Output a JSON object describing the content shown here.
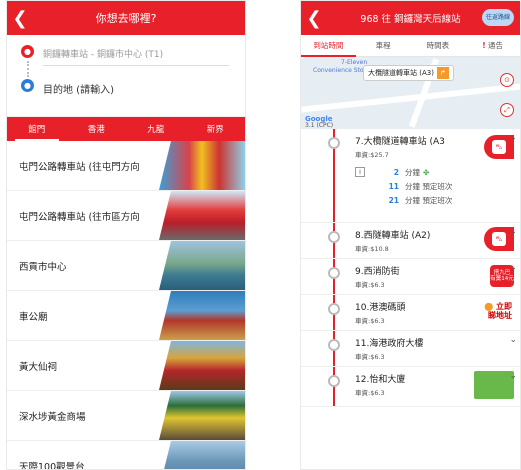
{
  "left": {
    "header_title": "你想去哪裡?",
    "origin": "銅鑼轉車站 - 銅鑼市中心 (T1)",
    "destination_placeholder": "目的地 (請輸入)",
    "tabs": [
      "館門",
      "香港",
      "九龍",
      "新界"
    ],
    "active_tab": 0,
    "places": [
      {
        "label": "屯門公路轉車站 (往屯門方向"
      },
      {
        "label": "屯門公路轉車站 (往市區方向"
      },
      {
        "label": "西貢市中心"
      },
      {
        "label": "車公廟"
      },
      {
        "label": "黃大仙祠"
      },
      {
        "label": "深水埗黃金商場"
      },
      {
        "label": "天際100觀景台"
      }
    ]
  },
  "right": {
    "header_title": "968 往 銅鑼灣天后線站",
    "header_pill": "往返路線",
    "tabs": [
      "到站時間",
      "車程",
      "時間表",
      "通告"
    ],
    "active_tab": 0,
    "map": {
      "callout": "大欖隧道轉車站 (A3)",
      "label_seven": "7-Eleven",
      "label_conv": "Convenience Store",
      "google": "Google",
      "bottom_left": "3.1 (CPC)"
    },
    "stops": [
      {
        "name": "7.大欖隧道轉車站 (A3",
        "fare": "車資:$25.7",
        "eta": [
          {
            "n": "2",
            "text": "分鐘"
          },
          {
            "n": "11",
            "text": "分鐘 預定班次"
          },
          {
            "n": "21",
            "text": "分鐘 預定班次"
          }
        ]
      },
      {
        "name": "8.西隧轉車站 (A2)",
        "fare": "車資:$10.8"
      },
      {
        "name": "9.西消防街",
        "fare": "車資:$6.3"
      },
      {
        "name": "10.港澳碼頭",
        "fare": "車資:$6.3"
      },
      {
        "name": "11.海港政府大樓",
        "fare": "車資:$6.3"
      },
      {
        "name": "12.怡和大廈",
        "fare": "車資:$6.3"
      }
    ],
    "walk_label": "立即\n睇地址",
    "ad_label": "搭九巴\n有獎14元"
  }
}
